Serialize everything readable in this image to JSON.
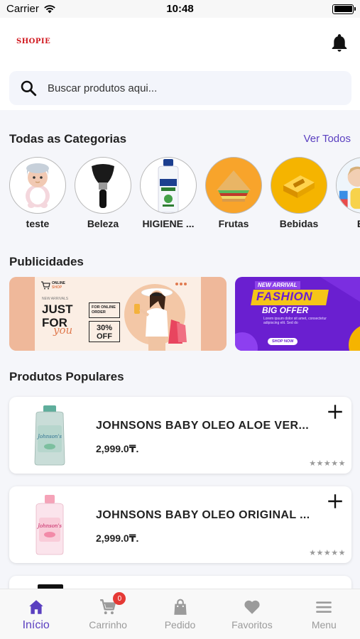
{
  "status_bar": {
    "carrier": "Carrier",
    "time": "10:48"
  },
  "header": {
    "logo_text": "SHOPIE",
    "search_placeholder": "Buscar produtos aqui..."
  },
  "categories_section": {
    "title": "Todas as Categorias",
    "see_all": "Ver Todos",
    "items": [
      {
        "label": "teste",
        "icon": "doll-image"
      },
      {
        "label": "Beleza",
        "icon": "makeup-brush-image"
      },
      {
        "label": "HIGIENE ...",
        "icon": "shampoo-bottle-image"
      },
      {
        "label": "Frutas",
        "icon": "sandwich-image"
      },
      {
        "label": "Bebidas",
        "icon": "drink-image"
      },
      {
        "label": "BA",
        "icon": "baby-image"
      }
    ]
  },
  "ads_section": {
    "title": "Publicidades",
    "banner1": {
      "brand": "ONLINE",
      "brand_sub": "SHOP",
      "kicker": "NEW ARRIVALS",
      "headline1": "JUST",
      "headline2": "FOR",
      "script": "you",
      "order_text": "FOR ONLINE ORDER",
      "discount": "30% OFF"
    },
    "banner2": {
      "kicker": "NEW ARRIVAL",
      "headline": "FASHION",
      "subheadline": "BIG OFFER",
      "body": "Lorem ipsum dolor sit amet, consectetur adipiscing elit. Sed do",
      "cta": "SHOP NOW"
    }
  },
  "popular_section": {
    "title": "Produtos Populares",
    "products": [
      {
        "name": "JOHNSONS BABY OLEO ALOE VER...",
        "price": "2,999.0₸.",
        "rating": "★★★★★"
      },
      {
        "name": "JOHNSONS BABY OLEO ORIGINAL ...",
        "price": "2,999.0₸.",
        "rating": "★★★★★"
      }
    ]
  },
  "tabbar": {
    "tabs": [
      {
        "label": "Início",
        "icon": "home-icon"
      },
      {
        "label": "Carrinho",
        "icon": "cart-icon",
        "badge": "0"
      },
      {
        "label": "Pedido",
        "icon": "bag-icon"
      },
      {
        "label": "Favoritos",
        "icon": "heart-icon"
      },
      {
        "label": "Menu",
        "icon": "menu-icon"
      }
    ]
  },
  "colors": {
    "accent": "#5a3fc0",
    "logo": "#d0161d",
    "badge": "#e53935",
    "banner2_bg": "#6a1fd0",
    "banner1_bg": "#f6d9c5"
  }
}
